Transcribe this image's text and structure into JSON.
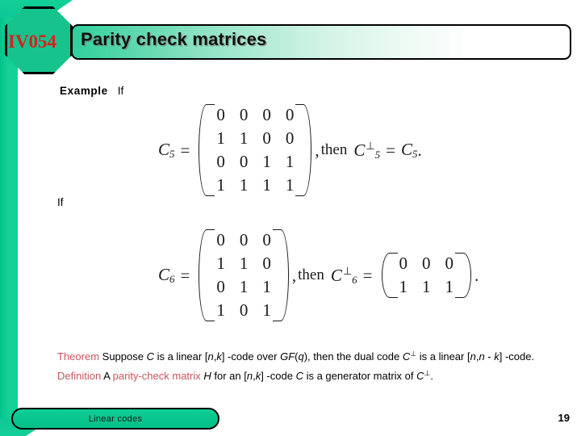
{
  "slide": {
    "badge_label": "IV054",
    "title": "Parity check matrices",
    "page_number": "19",
    "footer_label": "Linear codes",
    "accent_green": "#0fcd96",
    "badge_red": "#d82020",
    "prose_red": "#c8555f"
  },
  "body": {
    "example_keyword": "Example",
    "example_condition": "If",
    "second_condition": "If"
  },
  "equations": [
    {
      "id": "eq-c5",
      "lhs_symbol": "C",
      "lhs_subscript": "5",
      "equals": "=",
      "matrix": [
        [
          "0",
          "0",
          "0",
          "0"
        ],
        [
          "1",
          "1",
          "0",
          "0"
        ],
        [
          "0",
          "0",
          "1",
          "1"
        ],
        [
          "1",
          "1",
          "1",
          "1"
        ]
      ],
      "comma": ",",
      "then": "then",
      "rhs_symbol": "C",
      "rhs_subscript": "5",
      "rhs_superscript": "⊥",
      "rhs_equals": "=",
      "rhs_value_symbol": "C",
      "rhs_value_subscript": "5",
      "period": "."
    },
    {
      "id": "eq-c6",
      "lhs_symbol": "C",
      "lhs_subscript": "6",
      "equals": "=",
      "matrix": [
        [
          "0",
          "0",
          "0"
        ],
        [
          "1",
          "1",
          "0"
        ],
        [
          "0",
          "1",
          "1"
        ],
        [
          "1",
          "0",
          "1"
        ]
      ],
      "comma": ",",
      "then": "then",
      "rhs_symbol": "C",
      "rhs_subscript": "6",
      "rhs_superscript": "⊥",
      "rhs_equals": "=",
      "rhs_matrix": [
        [
          "0",
          "0",
          "0"
        ],
        [
          "1",
          "1",
          "1"
        ]
      ],
      "period": "."
    }
  ],
  "prose": {
    "theorem_keyword": "Theorem",
    "theorem_text_a": " Suppose ",
    "theorem_var_c": "C",
    "theorem_text_b": " is a linear [",
    "theorem_var_n": "n",
    "theorem_text_comma": ",",
    "theorem_var_k": "k",
    "theorem_text_c": "] -code over ",
    "theorem_gf": "GF",
    "theorem_text_d": "(",
    "theorem_var_q": "q",
    "theorem_text_e": "), then the dual code ",
    "theorem_dual_c": "C",
    "theorem_dual_perp": "⊥",
    "theorem_text_f": " is a linear [",
    "theorem_var_n2": "n",
    "theorem_text_comma2": ",",
    "theorem_var_n3": "n",
    "theorem_text_minus": " - ",
    "theorem_var_k2": "k",
    "theorem_text_end": "] -code.",
    "definition_keyword": "Definition",
    "definition_text_a": " A ",
    "definition_phrase": "parity-check matrix",
    "definition_var_h": "H",
    "definition_text_b": " for an [",
    "definition_var_n": "n",
    "definition_comma": ",",
    "definition_var_k": "k",
    "definition_text_c": "] -code ",
    "definition_var_c": "C",
    "definition_text_d": " is a generator matrix of ",
    "definition_dual_c": "C",
    "definition_dual_perp": "⊥",
    "definition_period": "."
  }
}
